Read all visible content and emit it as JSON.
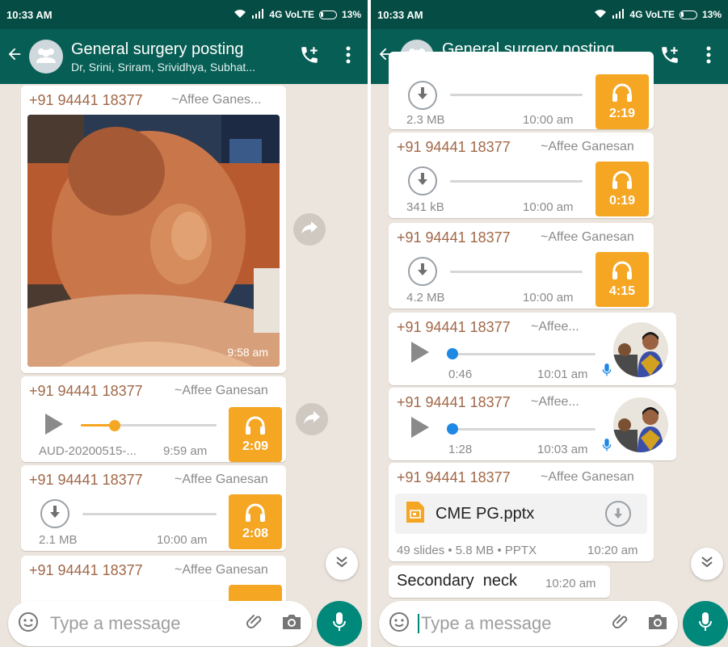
{
  "status": {
    "time": "10:33 AM",
    "network": "4G VoLTE",
    "battery": "13%"
  },
  "chat": {
    "title": "General surgery posting",
    "participants": "Dr, Srini, Sriram, Srividhya, Subhat..."
  },
  "left": {
    "photo_msg": {
      "sender": "+91 94441 18377",
      "alias": "~Affee Ganes...",
      "time": "9:58 am"
    },
    "audio1": {
      "sender": "+91 94441 18377",
      "alias": "~Affee Ganesan",
      "filename": "AUD-20200515-...",
      "time": "9:59 am",
      "duration": "2:09",
      "progress": 0.25
    },
    "audio2": {
      "sender": "+91 94441 18377",
      "alias": "~Affee Ganesan",
      "size": "2.1 MB",
      "time": "10:00 am",
      "duration": "2:08"
    },
    "audio3": {
      "sender": "+91 94441 18377",
      "alias": "~Affee Ganesan"
    }
  },
  "right": {
    "audio0": {
      "size": "2.3 MB",
      "time": "10:00 am",
      "duration": "2:19"
    },
    "audio1": {
      "sender": "+91 94441 18377",
      "alias": "~Affee Ganesan",
      "size": "341 kB",
      "time": "10:00 am",
      "duration": "0:19"
    },
    "audio2": {
      "sender": "+91 94441 18377",
      "alias": "~Affee Ganesan",
      "size": "4.2 MB",
      "time": "10:00 am",
      "duration": "4:15"
    },
    "voice1": {
      "sender": "+91 94441 18377",
      "alias": "~Affee...",
      "duration": "0:46",
      "time": "10:01 am"
    },
    "voice2": {
      "sender": "+91 94441 18377",
      "alias": "~Affee...",
      "duration": "1:28",
      "time": "10:03 am"
    },
    "doc": {
      "sender": "+91 94441 18377",
      "alias": "~Affee Ganesan",
      "filename": "CME PG.pptx",
      "meta": "49 slides • 5.8 MB • PPTX",
      "time": "10:20 am"
    },
    "text": {
      "body": "Secondary  neck",
      "time": "10:20 am"
    }
  },
  "composer": {
    "placeholder": "Type a message"
  },
  "icons": [
    "back-arrow-icon",
    "group-avatar-icon",
    "add-call-icon",
    "more-vert-icon",
    "forward-icon",
    "download-icon",
    "headphones-icon",
    "play-icon",
    "mic-icon",
    "emoji-icon",
    "attach-icon",
    "camera-icon",
    "scroll-down-icon",
    "pptx-file-icon"
  ],
  "colors": {
    "header": "#075e54",
    "statusbar": "#054d44",
    "accent": "#00897b",
    "audio_tile": "#f5a623",
    "sender": "#a06848",
    "chat_bg": "#ece5dd",
    "voice_dot": "#1e88e5"
  }
}
